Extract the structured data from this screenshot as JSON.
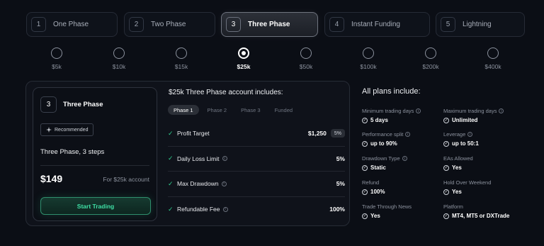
{
  "phase_tabs": [
    {
      "num": "1",
      "label": "One Phase"
    },
    {
      "num": "2",
      "label": "Two Phase"
    },
    {
      "num": "3",
      "label": "Three Phase"
    },
    {
      "num": "4",
      "label": "Instant Funding"
    },
    {
      "num": "5",
      "label": "Lightning"
    }
  ],
  "active_tab": 2,
  "prices": [
    "$5k",
    "$10k",
    "$15k",
    "$25k",
    "$50k",
    "$100k",
    "$200k",
    "$400k"
  ],
  "active_price": 3,
  "plan_card": {
    "num": "3",
    "title": "Three Phase",
    "badge": "Recommended",
    "subtitle": "Three Phase, 3 steps",
    "price": "$149",
    "for_text": "For $25k account",
    "button": "Start Trading"
  },
  "includes": {
    "title": "$25k Three Phase account includes:",
    "phases": [
      "Phase 1",
      "Phase 2",
      "Phase 3",
      "Funded"
    ],
    "active_phase": 0,
    "rows": [
      {
        "label": "Profit Target",
        "value": "$1,250",
        "badge": "5%"
      },
      {
        "label": "Daily Loss Limit",
        "value": "5%"
      },
      {
        "label": "Max Drawdown",
        "value": "5%"
      },
      {
        "label": "Refundable Fee",
        "value": "100%"
      }
    ]
  },
  "all_plans": {
    "title": "All plans include:",
    "features": [
      {
        "label": "Minimum trading days",
        "value": "5 days"
      },
      {
        "label": "Maximum trading days",
        "value": "Unlimited"
      },
      {
        "label": "Performance split",
        "value": "up to 90%"
      },
      {
        "label": "Leverage",
        "value": "up to 50:1"
      },
      {
        "label": "Drawdown Type",
        "value": "Static"
      },
      {
        "label": "EAs Allowed",
        "value": "Yes"
      },
      {
        "label": "Refund",
        "value": "100%"
      },
      {
        "label": "Hold Over Weekend",
        "value": "Yes"
      },
      {
        "label": "Trade Through News",
        "value": "Yes"
      },
      {
        "label": "Platform",
        "value": "MT4, MT5 or DXTrade"
      }
    ]
  },
  "colors": {
    "accent_green": "#3fe0a5",
    "background": "#0b0e15"
  }
}
